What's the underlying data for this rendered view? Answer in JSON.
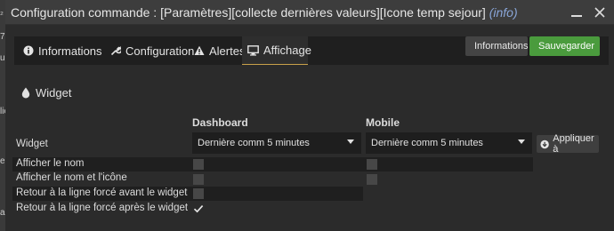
{
  "window": {
    "title_main": "Configuration commande : [Paramètres][collecte dernières valeurs][Icone temp sejour]",
    "title_info": "(info)"
  },
  "underlay": {
    "glyphs": [
      "₂",
      "7",
      "ur",
      "lio",
      "e",
      "a"
    ]
  },
  "tabs": [
    {
      "label": "Informations",
      "icon": "info-circle-icon"
    },
    {
      "label": "Configuration",
      "icon": "wrench-icon"
    },
    {
      "label": "Alertes",
      "icon": "exclamation-triangle-icon"
    },
    {
      "label": "Affichage",
      "icon": "desktop-icon"
    }
  ],
  "actions": {
    "info_label": "Informations",
    "save_label": "Sauvegarder"
  },
  "section": {
    "title": "Widget",
    "icon": "tint-icon"
  },
  "columns": {
    "dashboard": "Dashboard",
    "mobile": "Mobile"
  },
  "widget_row": {
    "label": "Widget",
    "dashboard_value": "Dernière comm 5 minutes",
    "mobile_value": "Dernière comm 5 minutes",
    "apply_label": "Appliquer à"
  },
  "options": [
    {
      "label": "Afficher le nom",
      "dashboard": false,
      "mobile": false
    },
    {
      "label": "Afficher le nom et l'icône",
      "dashboard": false,
      "mobile": false
    },
    {
      "label": "Retour à la ligne forcé avant le widget",
      "dashboard": false
    },
    {
      "label": "Retour à la ligne forcé après le widget",
      "dashboard": true
    }
  ],
  "colors": {
    "active_tab_underline": "#c8a14a",
    "save_green": "#4a9b3d",
    "info_link": "#8aa6d8"
  }
}
